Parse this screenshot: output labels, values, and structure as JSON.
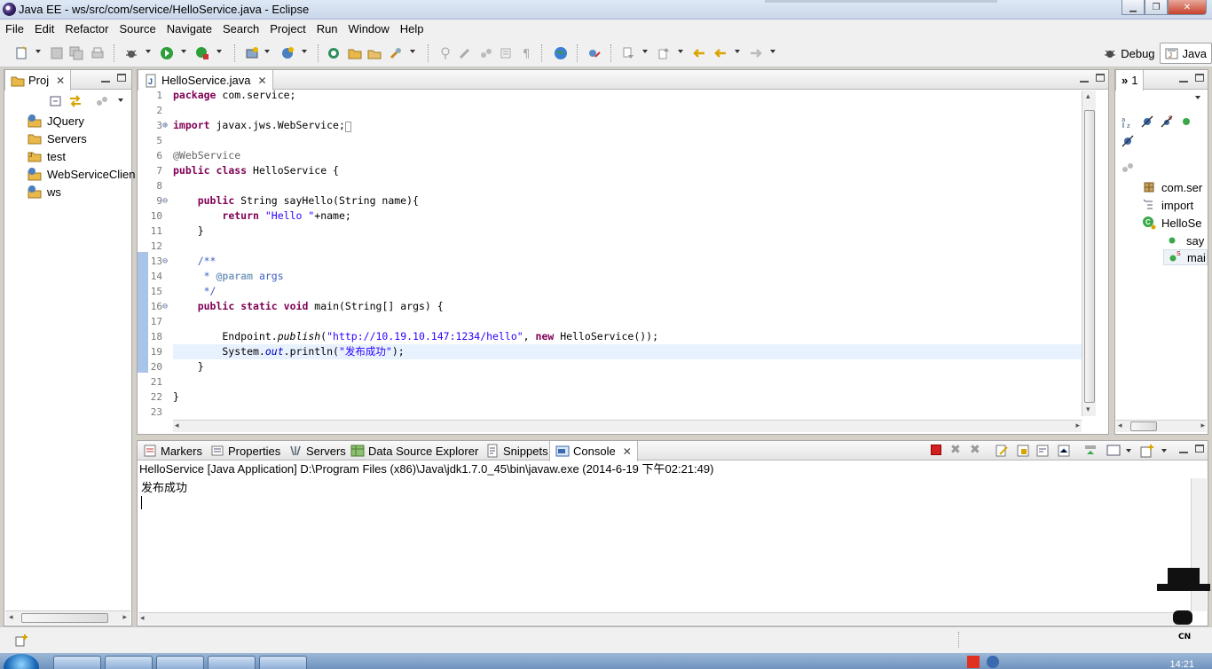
{
  "window": {
    "title": "Java EE - ws/src/com/service/HelloService.java - Eclipse"
  },
  "menubar": {
    "items": [
      "File",
      "Edit",
      "Refactor",
      "Source",
      "Navigate",
      "Search",
      "Project",
      "Run",
      "Window",
      "Help"
    ]
  },
  "perspectives": {
    "debug_label": "Debug",
    "java_label": "Java"
  },
  "project_explorer": {
    "tab_label": "Proj",
    "items": [
      "JQuery",
      "Servers",
      "test",
      "WebServiceClien",
      "ws"
    ]
  },
  "editor": {
    "tab_label": "HelloService.java",
    "line_numbers": [
      "1",
      "2",
      "3",
      "5",
      "6",
      "7",
      "8",
      "9",
      "10",
      "11",
      "12",
      "13",
      "14",
      "15",
      "16",
      "17",
      "18",
      "19",
      "20",
      "21",
      "22",
      "23"
    ]
  },
  "bottom_panel": {
    "tabs": [
      "Markers",
      "Properties",
      "Servers",
      "Data Source Explorer",
      "Snippets",
      "Console"
    ],
    "active_tab": "Console",
    "console_header": "HelloService [Java Application] D:\\Program Files (x86)\\Java\\jdk1.7.0_45\\bin\\javaw.exe (2014-6-19 下午02:21:49)",
    "console_output": "发布成功"
  },
  "outline": {
    "tab_label": "1",
    "items": [
      "com.ser",
      "import",
      "HelloSe",
      "say",
      "mai"
    ]
  },
  "taskbar": {
    "clock": "14:21"
  },
  "colors": {
    "keyword": "#7f0055",
    "string": "#2a00ff",
    "comment": "#3f5fbf",
    "annotation": "#646464",
    "current_line": "#e8f2fe"
  }
}
